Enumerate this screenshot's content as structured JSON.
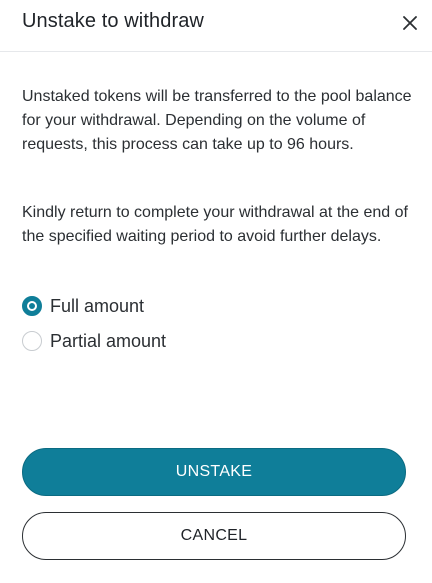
{
  "dialog": {
    "title": "Unstake to withdraw",
    "close_icon": "close-icon"
  },
  "body": {
    "paragraph_1": "Unstaked tokens will be transferred to the pool balance for your withdrawal. Depending on the volume of requests, this process can take up to 96 hours.",
    "paragraph_2": "Kindly return to complete your withdrawal at the end of the specified waiting period to avoid further delays."
  },
  "amount_options": [
    {
      "label": "Full amount",
      "selected": true
    },
    {
      "label": "Partial amount",
      "selected": false
    }
  ],
  "actions": {
    "primary_label": "UNSTAKE",
    "secondary_label": "CANCEL"
  },
  "colors": {
    "accent": "#0f7e99",
    "text": "#2b2f33",
    "divider": "#e6e8eb"
  }
}
